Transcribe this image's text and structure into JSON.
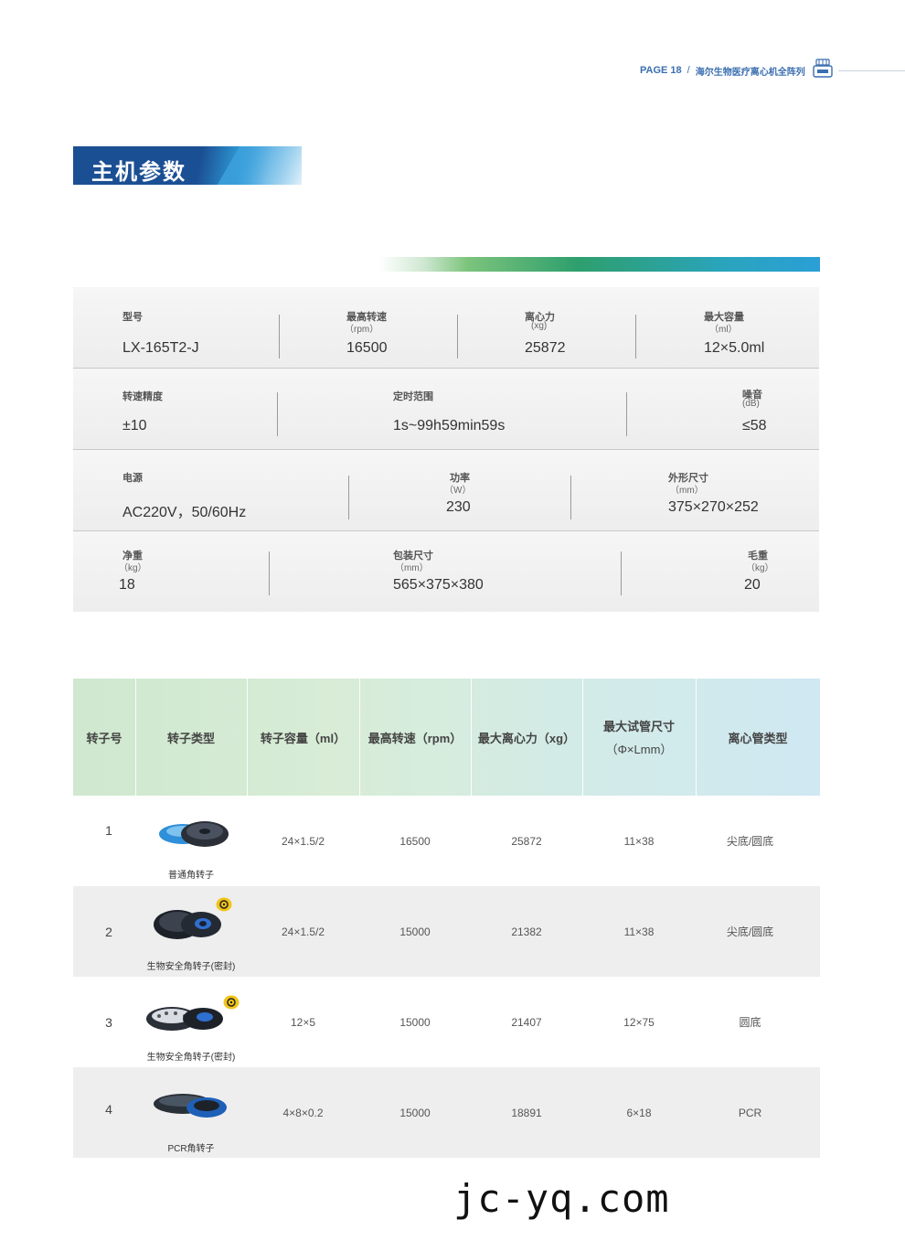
{
  "header": {
    "page": "PAGE 18",
    "slash": "/",
    "series": "海尔生物医疗离心机全阵列"
  },
  "section_title": "主机参数",
  "spec": {
    "row1": [
      {
        "label": "型号",
        "unit": "",
        "value": "LX-165T2-J"
      },
      {
        "label": "最高转速",
        "unit": "（rpm）",
        "value": "16500"
      },
      {
        "label": "离心力",
        "unit": "(xg)",
        "value": "25872"
      },
      {
        "label": "最大容量",
        "unit": "（ml）",
        "value": "12×5.0ml"
      }
    ],
    "row2": [
      {
        "label": "转速精度",
        "unit": "",
        "value": "±10"
      },
      {
        "label": "定时范围",
        "unit": "",
        "value": "1s~99h59min59s"
      },
      {
        "label": "噪音",
        "unit": "(dB)",
        "value": "≤58"
      }
    ],
    "row3": [
      {
        "label": "电源",
        "unit": "",
        "value": "AC220V，50/60Hz"
      },
      {
        "label": "功率",
        "unit": "（W）",
        "value": "230"
      },
      {
        "label": "外形尺寸",
        "unit": "（mm）",
        "value": "375×270×252"
      }
    ],
    "row4": [
      {
        "label": "净重",
        "unit": "（kg）",
        "value": "18"
      },
      {
        "label": "包装尺寸",
        "unit": "（mm）",
        "value": "565×375×380"
      },
      {
        "label": "毛重",
        "unit": "（kg）",
        "value": "20"
      }
    ]
  },
  "rotor_table": {
    "headers": [
      "转子号",
      "转子类型",
      "转子容量（ml）",
      "最高转速（rpm）",
      "最大离心力（xg）",
      "最大试管尺寸",
      "（Φ×Lmm）",
      "离心管类型"
    ],
    "rows": [
      {
        "no": "1",
        "type": "普通角转子",
        "capacity": "24×1.5/2",
        "speed": "16500",
        "rcf": "25872",
        "tube": "11×38",
        "tube_type": "尖底/圆底",
        "biohazard": false
      },
      {
        "no": "2",
        "type": "生物安全角转子(密封)",
        "capacity": "24×1.5/2",
        "speed": "15000",
        "rcf": "21382",
        "tube": "11×38",
        "tube_type": "尖底/圆底",
        "biohazard": true
      },
      {
        "no": "3",
        "type": "生物安全角转子(密封)",
        "capacity": "12×5",
        "speed": "15000",
        "rcf": "21407",
        "tube": "12×75",
        "tube_type": "圆底",
        "biohazard": true
      },
      {
        "no": "4",
        "type": "PCR角转子",
        "capacity": "4×8×0.2",
        "speed": "15000",
        "rcf": "18891",
        "tube": "6×18",
        "tube_type": "PCR",
        "biohazard": false
      }
    ]
  },
  "watermark": "jc-yq.com",
  "icons": {
    "header_icon": "centrifuge-icon",
    "biohazard_icon": "biohazard-icon"
  }
}
